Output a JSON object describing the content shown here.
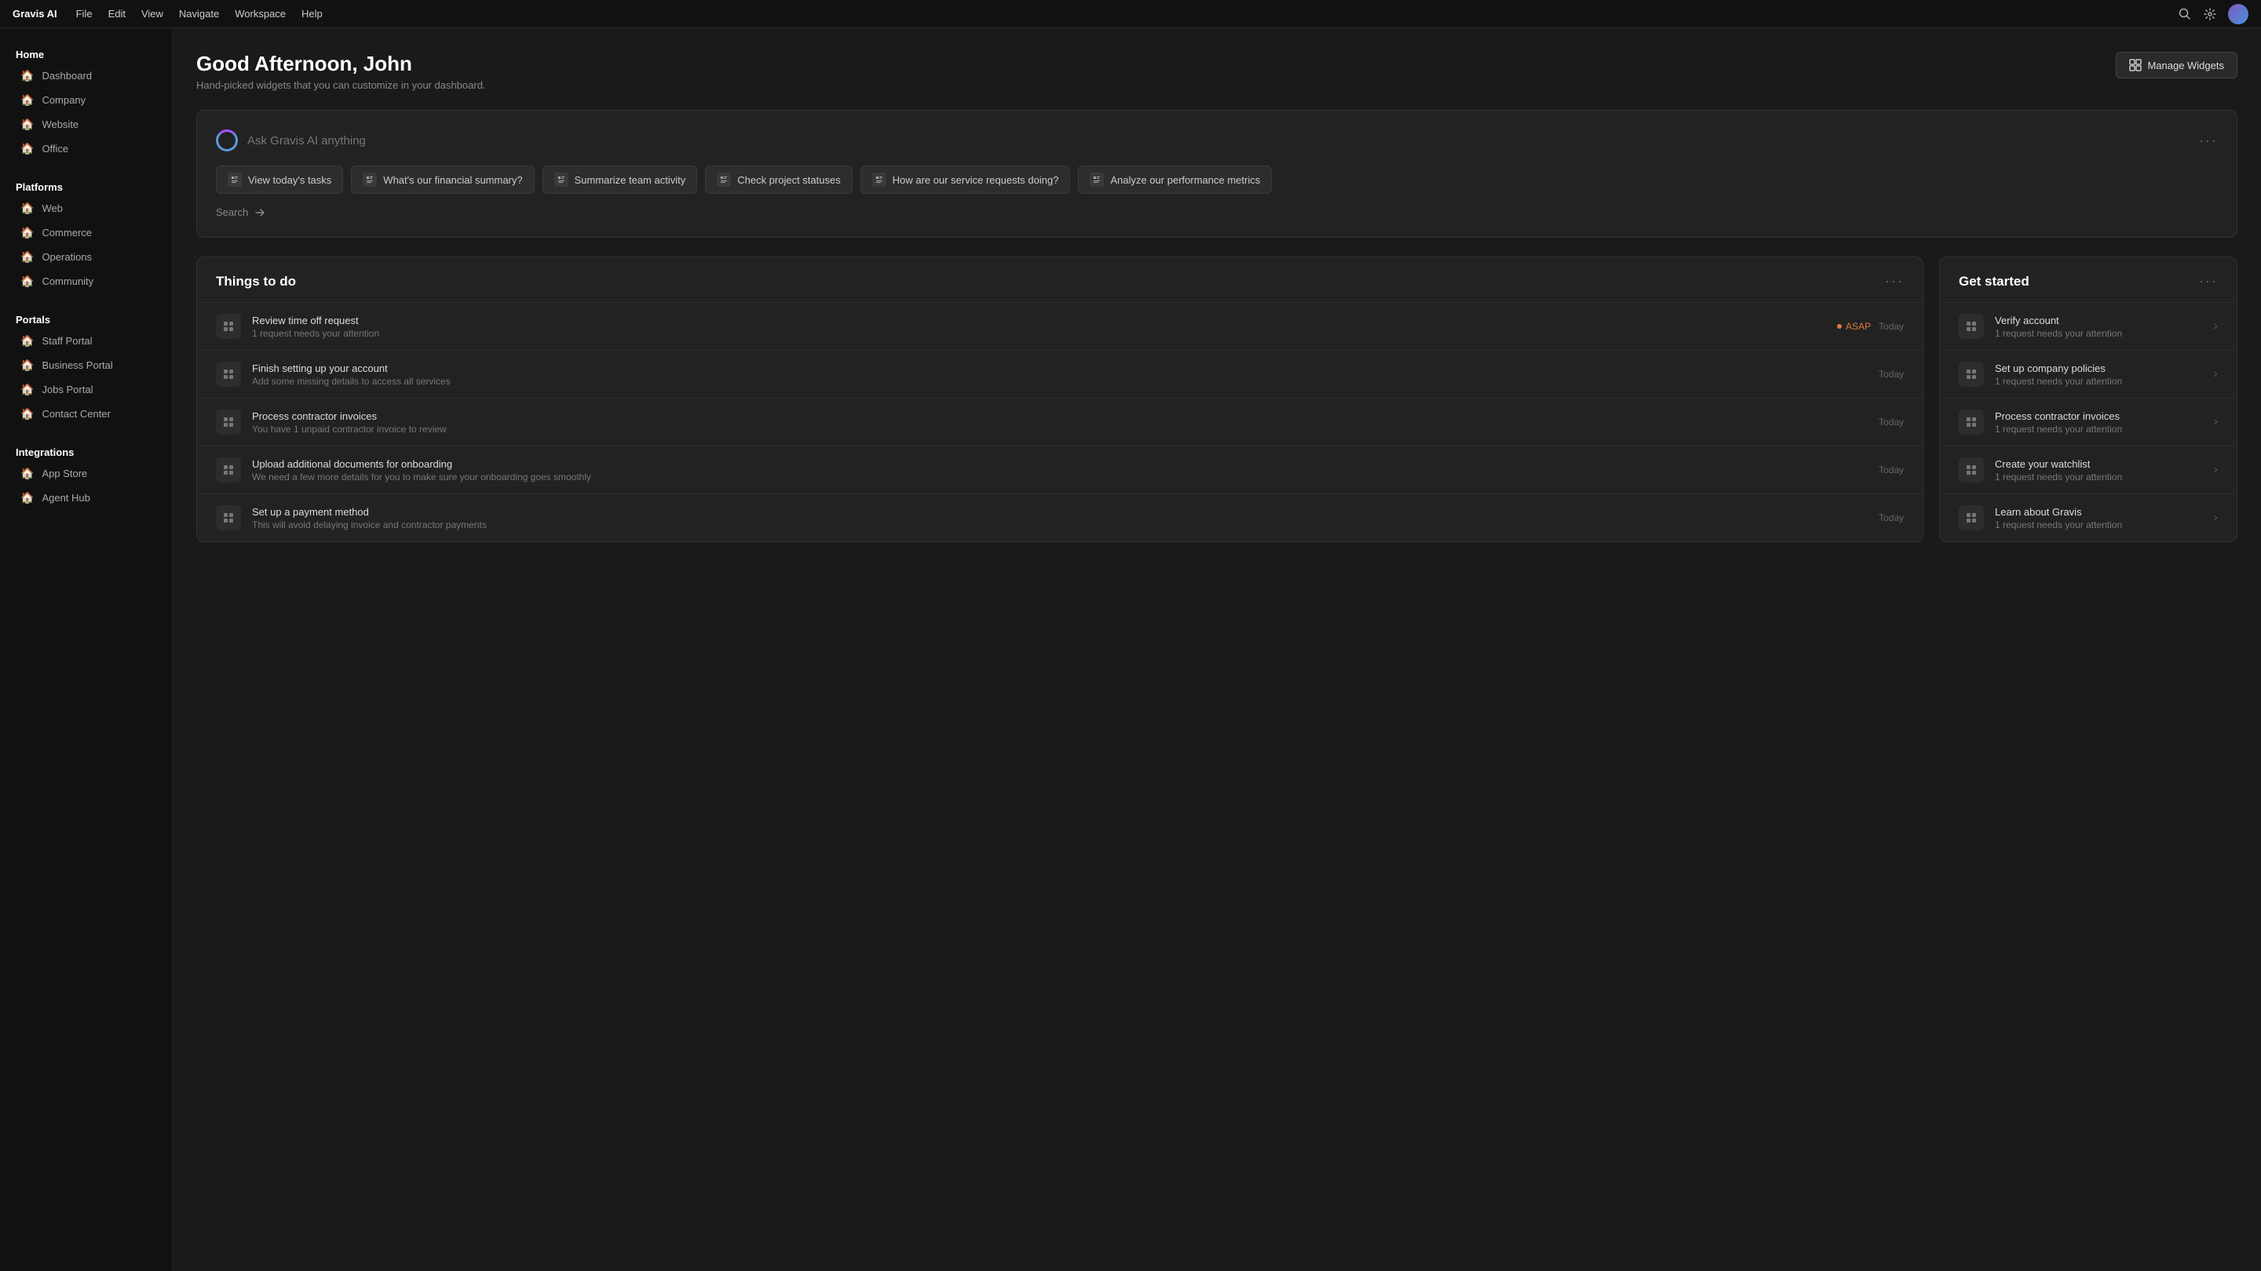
{
  "app": {
    "brand": "Gravis AI",
    "menu_items": [
      "File",
      "Edit",
      "View",
      "Navigate",
      "Workspace",
      "Help"
    ]
  },
  "sidebar": {
    "sections": [
      {
        "title": "Home",
        "items": [
          {
            "label": "Dashboard",
            "icon": "🏠"
          },
          {
            "label": "Company",
            "icon": "🏠"
          },
          {
            "label": "Website",
            "icon": "🏠"
          },
          {
            "label": "Office",
            "icon": "🏠"
          }
        ]
      },
      {
        "title": "Platforms",
        "items": [
          {
            "label": "Web",
            "icon": "🏠"
          },
          {
            "label": "Commerce",
            "icon": "🏠"
          },
          {
            "label": "Operations",
            "icon": "🏠"
          },
          {
            "label": "Community",
            "icon": "🏠"
          }
        ]
      },
      {
        "title": "Portals",
        "items": [
          {
            "label": "Staff Portal",
            "icon": "🏠"
          },
          {
            "label": "Business Portal",
            "icon": "🏠"
          },
          {
            "label": "Jobs Portal",
            "icon": "🏠"
          },
          {
            "label": "Contact Center",
            "icon": "🏠"
          }
        ]
      },
      {
        "title": "Integrations",
        "items": [
          {
            "label": "App Store",
            "icon": "🏠"
          },
          {
            "label": "Agent Hub",
            "icon": "🏠"
          }
        ]
      }
    ]
  },
  "header": {
    "greeting": "Good Afternoon, John",
    "subtitle": "Hand-picked widgets that you can customize in your dashboard.",
    "manage_btn": "Manage Widgets"
  },
  "ai_box": {
    "placeholder": "Ask Gravis AI anything",
    "chips": [
      {
        "label": "View today's tasks"
      },
      {
        "label": "What's our financial summary?"
      },
      {
        "label": "Summarize team activity"
      },
      {
        "label": "Check project statuses"
      },
      {
        "label": "How are our service requests doing?"
      },
      {
        "label": "Analyze our performance metrics"
      }
    ],
    "search_label": "Search"
  },
  "todos": {
    "title": "Things to do",
    "items": [
      {
        "title": "Review time off request",
        "subtitle": "1 request needs your attention",
        "badge": "ASAP",
        "date": "Today"
      },
      {
        "title": "Finish setting up your account",
        "subtitle": "Add some missing details to access all services",
        "badge": null,
        "date": "Today"
      },
      {
        "title": "Process contractor invoices",
        "subtitle": "You have 1 unpaid contractor invoice to review",
        "badge": null,
        "date": "Today"
      },
      {
        "title": "Upload additional documents for onboarding",
        "subtitle": "We need a few more details for you to make sure your onboarding goes smoothly",
        "badge": null,
        "date": "Today"
      },
      {
        "title": "Set up a payment method",
        "subtitle": "This will avoid delaying invoice and contractor payments",
        "badge": null,
        "date": "Today"
      }
    ]
  },
  "get_started": {
    "title": "Get started",
    "items": [
      {
        "title": "Verify account",
        "subtitle": "1 request needs your attention"
      },
      {
        "title": "Set up company policies",
        "subtitle": "1 request needs your attention"
      },
      {
        "title": "Process contractor invoices",
        "subtitle": "1 request needs your attention"
      },
      {
        "title": "Create your watchlist",
        "subtitle": "1 request needs your attention"
      },
      {
        "title": "Learn about Gravis",
        "subtitle": "1 request needs your attention"
      }
    ]
  }
}
